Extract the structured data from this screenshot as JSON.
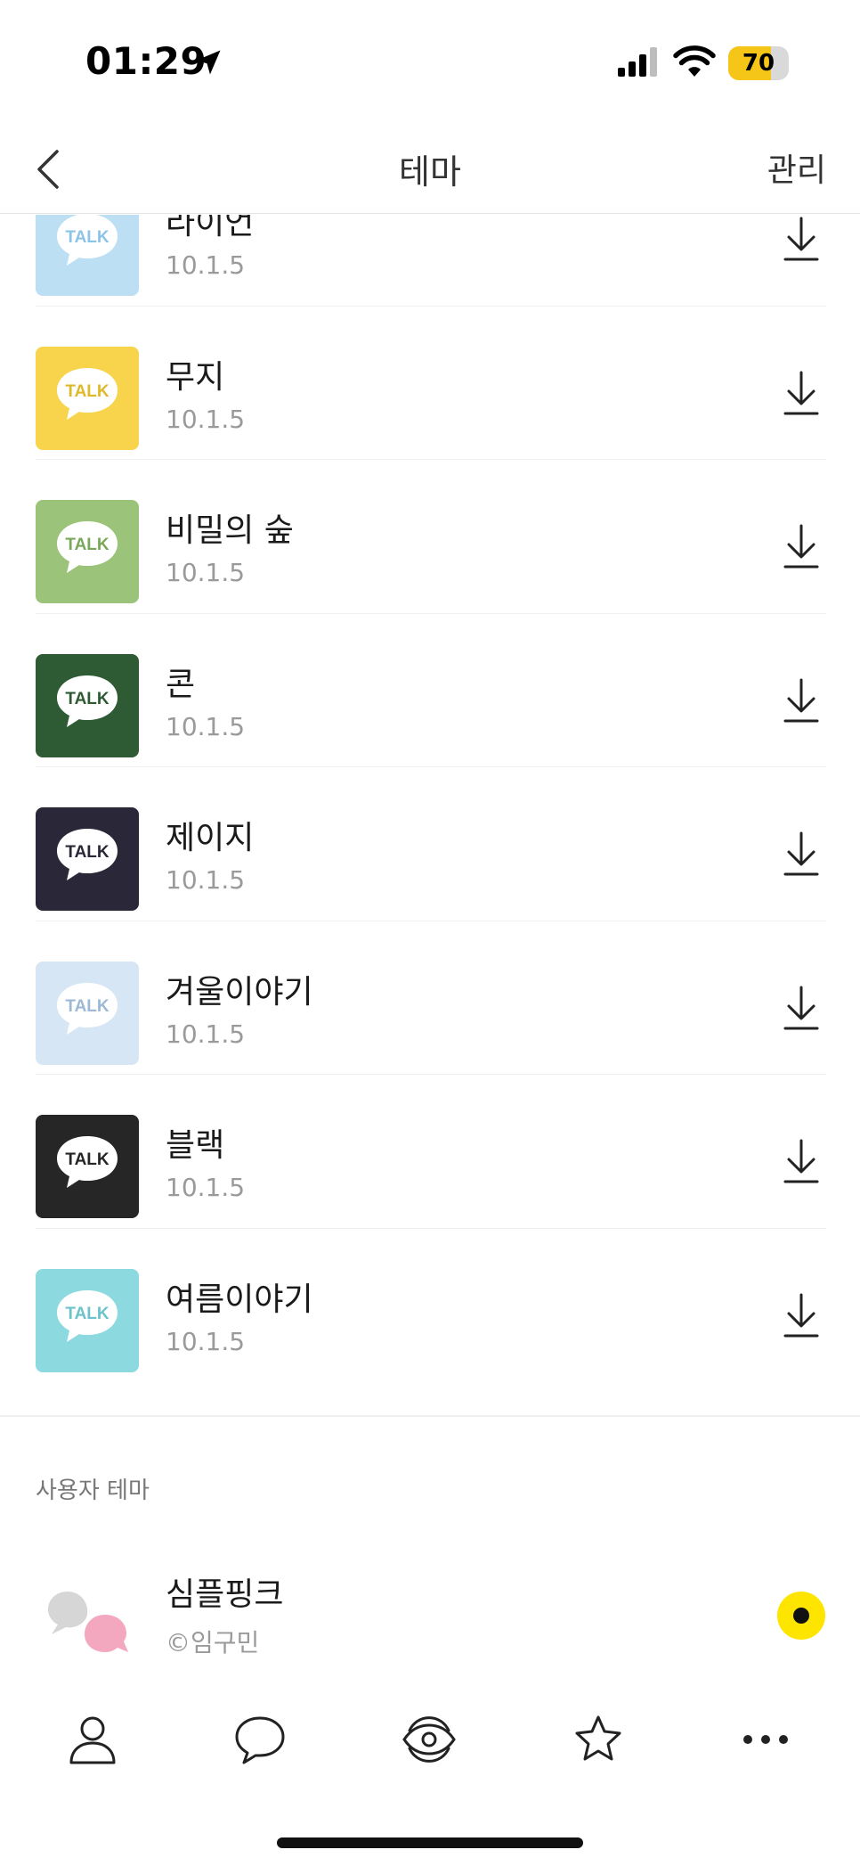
{
  "status_bar": {
    "time": "01:29",
    "battery_level": "70",
    "battery_fraction": 0.7,
    "icons": [
      "location-arrow-icon",
      "cellular-signal-icon",
      "wifi-icon",
      "battery-icon"
    ]
  },
  "header": {
    "title": "테마",
    "manage_label": "관리",
    "back_icon": "chevron-left-icon"
  },
  "themes": [
    {
      "name": "라이언",
      "version": "10.1.5",
      "bg": "#bcdff4",
      "bubble_text": "TALK",
      "bubble_text_color": "#8cc4e8",
      "download_icon": "download-icon"
    },
    {
      "name": "무지",
      "version": "10.1.5",
      "bg": "#f7d44c",
      "bubble_text": "TALK",
      "bubble_text_color": "#e0b92a",
      "download_icon": "download-icon"
    },
    {
      "name": "비밀의 숲",
      "version": "10.1.5",
      "bg": "#9bc47a",
      "bubble_text": "TALK",
      "bubble_text_color": "#7aa85a",
      "download_icon": "download-icon"
    },
    {
      "name": "콘",
      "version": "10.1.5",
      "bg": "#2e5a34",
      "bubble_text": "TALK",
      "bubble_text_color": "#2e5a34",
      "download_icon": "download-icon"
    },
    {
      "name": "제이지",
      "version": "10.1.5",
      "bg": "#2a2838",
      "bubble_text": "TALK",
      "bubble_text_color": "#2a2838",
      "download_icon": "download-icon"
    },
    {
      "name": "겨울이야기",
      "version": "10.1.5",
      "bg": "#d7e6f5",
      "bubble_text": "TALK",
      "bubble_text_color": "#9cb9d6",
      "download_icon": "download-icon"
    },
    {
      "name": "블랙",
      "version": "10.1.5",
      "bg": "#262626",
      "bubble_text": "TALK",
      "bubble_text_color": "#262626",
      "download_icon": "download-icon"
    },
    {
      "name": "여름이야기",
      "version": "10.1.5",
      "bg": "#8cd9e0",
      "bubble_text": "TALK",
      "bubble_text_color": "#6cc3cc",
      "download_icon": "download-icon"
    }
  ],
  "user_section": {
    "title": "사용자 테마",
    "items": [
      {
        "name": "심플핑크",
        "author": "©임구민",
        "selected": true
      }
    ]
  },
  "tab_bar": {
    "tabs": [
      {
        "icon": "person-icon"
      },
      {
        "icon": "chat-bubble-icon"
      },
      {
        "icon": "view-eye-icon"
      },
      {
        "icon": "star-icon"
      },
      {
        "icon": "more-dots-icon"
      }
    ]
  },
  "colors": {
    "accent_yellow": "#fee500",
    "battery_yellow": "#f5c518"
  }
}
